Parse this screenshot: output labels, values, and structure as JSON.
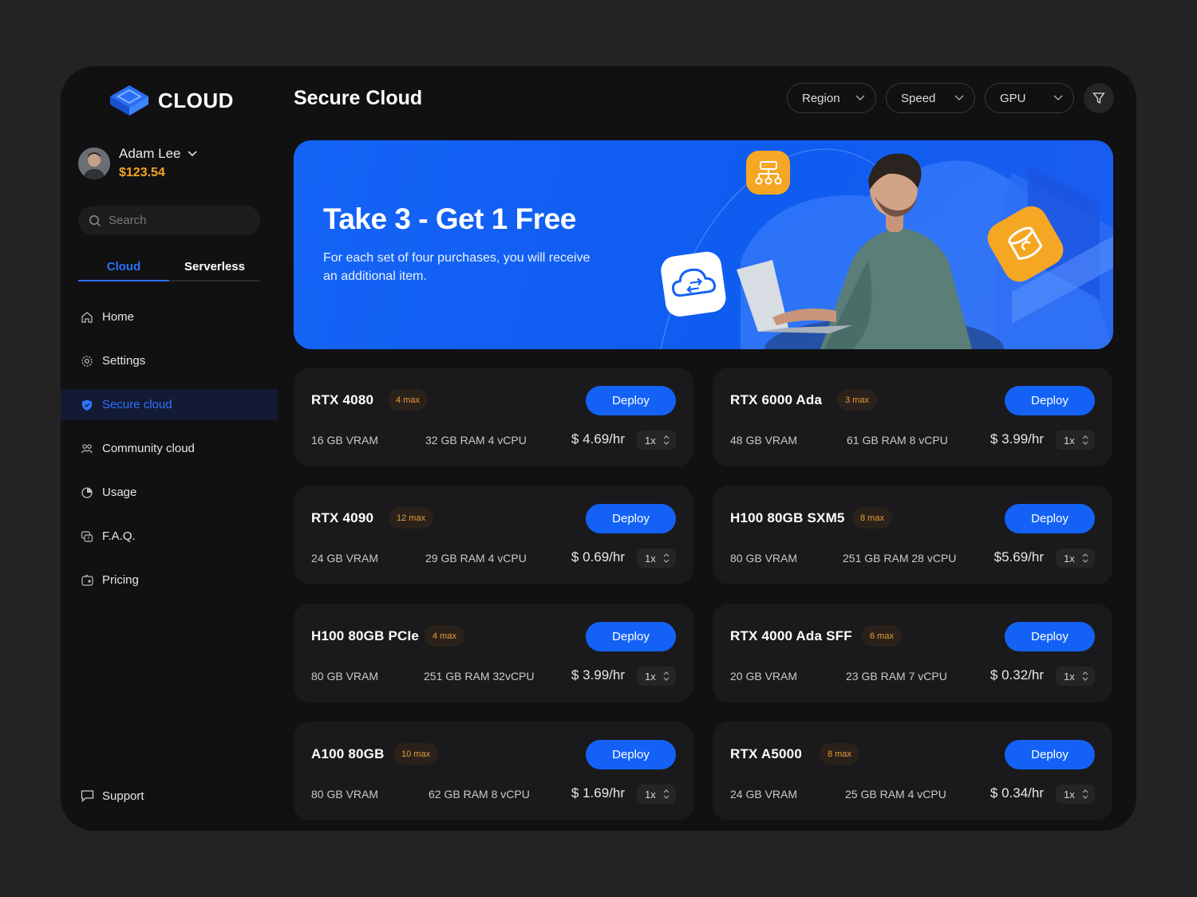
{
  "brand": {
    "name": "CLOUD",
    "accent": "#1462f5",
    "balance_color": "#f5a623"
  },
  "user": {
    "name": "Adam Lee",
    "balance": "$123.54"
  },
  "search": {
    "placeholder": "Search"
  },
  "segments": [
    {
      "label": "Cloud",
      "active": true
    },
    {
      "label": "Serverless",
      "active": false
    }
  ],
  "nav": [
    {
      "label": "Home",
      "icon": "home-icon"
    },
    {
      "label": "Settings",
      "icon": "gear-icon"
    },
    {
      "label": "Secure cloud",
      "icon": "shield-icon",
      "active": true
    },
    {
      "label": "Community cloud",
      "icon": "community-icon"
    },
    {
      "label": "Usage",
      "icon": "usage-icon"
    },
    {
      "label": "F.A.Q.",
      "icon": "faq-icon"
    },
    {
      "label": "Pricing",
      "icon": "pricing-icon"
    }
  ],
  "support": {
    "label": "Support",
    "icon": "chat-icon"
  },
  "header": {
    "title": "Secure Cloud",
    "filters": [
      "Region",
      "Speed",
      "GPU"
    ]
  },
  "banner": {
    "title": "Take 3 - Get 1 Free",
    "description": "For each set of four purchases, you will receive an additional item."
  },
  "gpus": [
    {
      "name": "RTX 4080",
      "max": "4 max",
      "vram": "16 GB VRAM",
      "ram_cpu": "32 GB RAM 4 vCPU",
      "price": "$ 4.69/hr",
      "qty": "1x",
      "deploy": "Deploy"
    },
    {
      "name": "RTX 6000 Ada",
      "max": "3 max",
      "vram": "48 GB VRAM",
      "ram_cpu": "61 GB RAM 8 vCPU",
      "price": "$ 3.99/hr",
      "qty": "1x",
      "deploy": "Deploy"
    },
    {
      "name": "RTX 4090",
      "max": "12 max",
      "vram": "24 GB VRAM",
      "ram_cpu": "29 GB RAM 4 vCPU",
      "price": "$ 0.69/hr",
      "qty": "1x",
      "deploy": "Deploy"
    },
    {
      "name": "H100 80GB SXM5",
      "max": "8 max",
      "vram": "80 GB VRAM",
      "ram_cpu": "251 GB RAM 28 vCPU",
      "price": "$5.69/hr",
      "qty": "1x",
      "deploy": "Deploy"
    },
    {
      "name": "H100 80GB PCIe",
      "max": "4 max",
      "vram": "80 GB VRAM",
      "ram_cpu": "251 GB RAM 32vCPU",
      "price": "$ 3.99/hr",
      "qty": "1x",
      "deploy": "Deploy"
    },
    {
      "name": "RTX 4000 Ada SFF",
      "max": "6 max",
      "vram": "20 GB VRAM",
      "ram_cpu": "23 GB RAM 7 vCPU",
      "price": "$ 0.32/hr",
      "qty": "1x",
      "deploy": "Deploy"
    },
    {
      "name": "A100 80GB",
      "max": "10 max",
      "vram": "80 GB VRAM",
      "ram_cpu": "62 GB RAM 8 vCPU",
      "price": "$ 1.69/hr",
      "qty": "1x",
      "deploy": "Deploy"
    },
    {
      "name": "RTX A5000",
      "max": "8 max",
      "vram": "24 GB VRAM",
      "ram_cpu": "25 GB RAM 4 vCPU",
      "price": "$ 0.34/hr",
      "qty": "1x",
      "deploy": "Deploy"
    }
  ]
}
